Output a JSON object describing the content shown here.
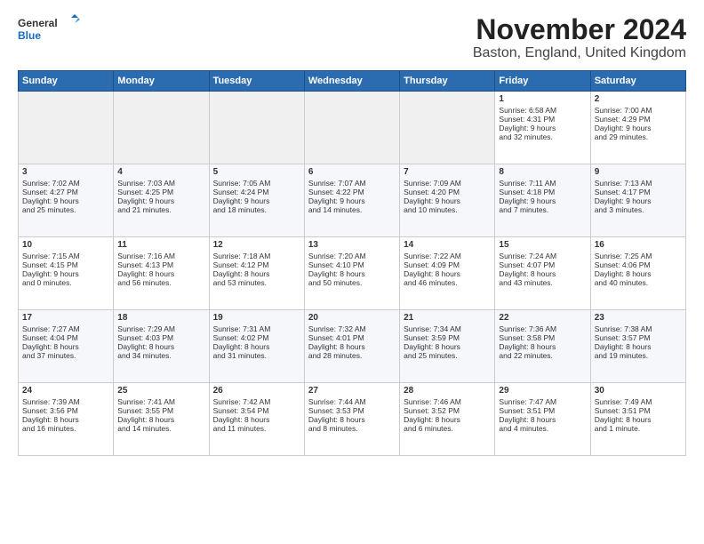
{
  "header": {
    "logo_general": "General",
    "logo_blue": "Blue",
    "title": "November 2024",
    "subtitle": "Baston, England, United Kingdom"
  },
  "days_of_week": [
    "Sunday",
    "Monday",
    "Tuesday",
    "Wednesday",
    "Thursday",
    "Friday",
    "Saturday"
  ],
  "weeks": [
    [
      {
        "day": "",
        "content": ""
      },
      {
        "day": "",
        "content": ""
      },
      {
        "day": "",
        "content": ""
      },
      {
        "day": "",
        "content": ""
      },
      {
        "day": "",
        "content": ""
      },
      {
        "day": "1",
        "content": "Sunrise: 6:58 AM\nSunset: 4:31 PM\nDaylight: 9 hours\nand 32 minutes."
      },
      {
        "day": "2",
        "content": "Sunrise: 7:00 AM\nSunset: 4:29 PM\nDaylight: 9 hours\nand 29 minutes."
      }
    ],
    [
      {
        "day": "3",
        "content": "Sunrise: 7:02 AM\nSunset: 4:27 PM\nDaylight: 9 hours\nand 25 minutes."
      },
      {
        "day": "4",
        "content": "Sunrise: 7:03 AM\nSunset: 4:25 PM\nDaylight: 9 hours\nand 21 minutes."
      },
      {
        "day": "5",
        "content": "Sunrise: 7:05 AM\nSunset: 4:24 PM\nDaylight: 9 hours\nand 18 minutes."
      },
      {
        "day": "6",
        "content": "Sunrise: 7:07 AM\nSunset: 4:22 PM\nDaylight: 9 hours\nand 14 minutes."
      },
      {
        "day": "7",
        "content": "Sunrise: 7:09 AM\nSunset: 4:20 PM\nDaylight: 9 hours\nand 10 minutes."
      },
      {
        "day": "8",
        "content": "Sunrise: 7:11 AM\nSunset: 4:18 PM\nDaylight: 9 hours\nand 7 minutes."
      },
      {
        "day": "9",
        "content": "Sunrise: 7:13 AM\nSunset: 4:17 PM\nDaylight: 9 hours\nand 3 minutes."
      }
    ],
    [
      {
        "day": "10",
        "content": "Sunrise: 7:15 AM\nSunset: 4:15 PM\nDaylight: 9 hours\nand 0 minutes."
      },
      {
        "day": "11",
        "content": "Sunrise: 7:16 AM\nSunset: 4:13 PM\nDaylight: 8 hours\nand 56 minutes."
      },
      {
        "day": "12",
        "content": "Sunrise: 7:18 AM\nSunset: 4:12 PM\nDaylight: 8 hours\nand 53 minutes."
      },
      {
        "day": "13",
        "content": "Sunrise: 7:20 AM\nSunset: 4:10 PM\nDaylight: 8 hours\nand 50 minutes."
      },
      {
        "day": "14",
        "content": "Sunrise: 7:22 AM\nSunset: 4:09 PM\nDaylight: 8 hours\nand 46 minutes."
      },
      {
        "day": "15",
        "content": "Sunrise: 7:24 AM\nSunset: 4:07 PM\nDaylight: 8 hours\nand 43 minutes."
      },
      {
        "day": "16",
        "content": "Sunrise: 7:25 AM\nSunset: 4:06 PM\nDaylight: 8 hours\nand 40 minutes."
      }
    ],
    [
      {
        "day": "17",
        "content": "Sunrise: 7:27 AM\nSunset: 4:04 PM\nDaylight: 8 hours\nand 37 minutes."
      },
      {
        "day": "18",
        "content": "Sunrise: 7:29 AM\nSunset: 4:03 PM\nDaylight: 8 hours\nand 34 minutes."
      },
      {
        "day": "19",
        "content": "Sunrise: 7:31 AM\nSunset: 4:02 PM\nDaylight: 8 hours\nand 31 minutes."
      },
      {
        "day": "20",
        "content": "Sunrise: 7:32 AM\nSunset: 4:01 PM\nDaylight: 8 hours\nand 28 minutes."
      },
      {
        "day": "21",
        "content": "Sunrise: 7:34 AM\nSunset: 3:59 PM\nDaylight: 8 hours\nand 25 minutes."
      },
      {
        "day": "22",
        "content": "Sunrise: 7:36 AM\nSunset: 3:58 PM\nDaylight: 8 hours\nand 22 minutes."
      },
      {
        "day": "23",
        "content": "Sunrise: 7:38 AM\nSunset: 3:57 PM\nDaylight: 8 hours\nand 19 minutes."
      }
    ],
    [
      {
        "day": "24",
        "content": "Sunrise: 7:39 AM\nSunset: 3:56 PM\nDaylight: 8 hours\nand 16 minutes."
      },
      {
        "day": "25",
        "content": "Sunrise: 7:41 AM\nSunset: 3:55 PM\nDaylight: 8 hours\nand 14 minutes."
      },
      {
        "day": "26",
        "content": "Sunrise: 7:42 AM\nSunset: 3:54 PM\nDaylight: 8 hours\nand 11 minutes."
      },
      {
        "day": "27",
        "content": "Sunrise: 7:44 AM\nSunset: 3:53 PM\nDaylight: 8 hours\nand 8 minutes."
      },
      {
        "day": "28",
        "content": "Sunrise: 7:46 AM\nSunset: 3:52 PM\nDaylight: 8 hours\nand 6 minutes."
      },
      {
        "day": "29",
        "content": "Sunrise: 7:47 AM\nSunset: 3:51 PM\nDaylight: 8 hours\nand 4 minutes."
      },
      {
        "day": "30",
        "content": "Sunrise: 7:49 AM\nSunset: 3:51 PM\nDaylight: 8 hours\nand 1 minute."
      }
    ]
  ]
}
